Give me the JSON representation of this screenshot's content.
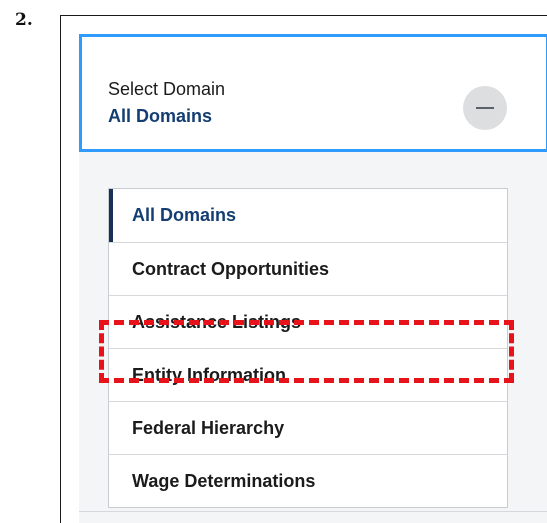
{
  "step": {
    "number": "2."
  },
  "selector": {
    "label": "Select Domain",
    "selected": "All Domains",
    "toggle_icon": "minus-icon"
  },
  "domains": [
    {
      "label": "All Domains",
      "active": true
    },
    {
      "label": "Contract Opportunities",
      "active": false
    },
    {
      "label": "Assistance Listings",
      "active": false
    },
    {
      "label": "Entity Information",
      "active": false,
      "highlighted": true
    },
    {
      "label": "Federal Hierarchy",
      "active": false
    },
    {
      "label": "Wage Determinations",
      "active": false
    }
  ],
  "colors": {
    "selector_border": "#2f9bff",
    "selected_text": "#143e72",
    "active_indicator": "#1a2f55",
    "highlight": "#e8121b"
  }
}
